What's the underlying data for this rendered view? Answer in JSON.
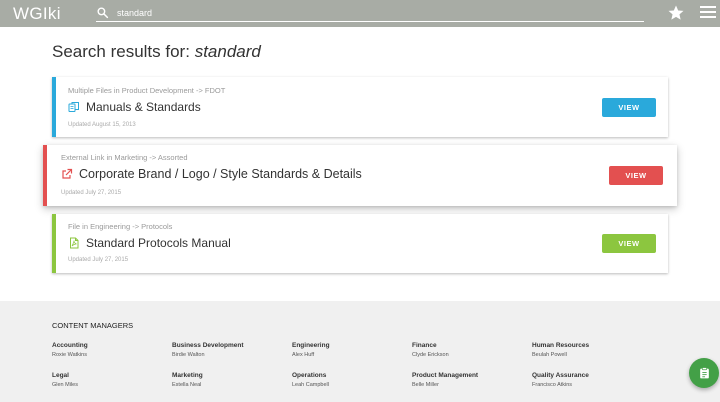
{
  "app": {
    "logo": "WGIki"
  },
  "search": {
    "value": "standard",
    "placeholder": ""
  },
  "results": {
    "heading_prefix": "Search results for:",
    "query": "standard",
    "items": [
      {
        "meta": "Multiple Files in Product Development -> FDOT",
        "title": "Manuals & Standards",
        "updated": "Updated August 15, 2013",
        "button": "VIEW",
        "icon": "files-icon",
        "color": "#2aa9db"
      },
      {
        "meta": "External Link in Marketing -> Assorted",
        "title": "Corporate Brand / Logo / Style Standards & Details",
        "updated": "Updated July 27, 2015",
        "button": "VIEW",
        "icon": "external-link-icon",
        "color": "#e35050"
      },
      {
        "meta": "File in Engineering -> Protocols",
        "title": "Standard Protocols Manual",
        "updated": "Updated July 27, 2015",
        "button": "VIEW",
        "icon": "pdf-file-icon",
        "color": "#8cc63f"
      }
    ]
  },
  "footer": {
    "heading": "CONTENT MANAGERS",
    "managers": [
      {
        "dept": "Accounting",
        "name": "Roxie Watkins"
      },
      {
        "dept": "Business Development",
        "name": "Birdie Walton"
      },
      {
        "dept": "Engineering",
        "name": "Alex Huff"
      },
      {
        "dept": "Finance",
        "name": "Clyde Erickson"
      },
      {
        "dept": "Human Resources",
        "name": "Beulah Powell"
      },
      {
        "dept": "Legal",
        "name": "Glen Miles"
      },
      {
        "dept": "Marketing",
        "name": "Estella Neal"
      },
      {
        "dept": "Operations",
        "name": "Leah Campbell"
      },
      {
        "dept": "Product Management",
        "name": "Belle Miller"
      },
      {
        "dept": "Quality Assurance",
        "name": "Francisco Atkins"
      }
    ]
  },
  "icons": {
    "topbar": [
      "search-icon",
      "star-icon",
      "menu-icon"
    ],
    "fab": "clipboard-icon"
  },
  "colors": {
    "topbar": "#a8aca5",
    "footer": "#f0f0f0",
    "fab": "#43a047"
  }
}
